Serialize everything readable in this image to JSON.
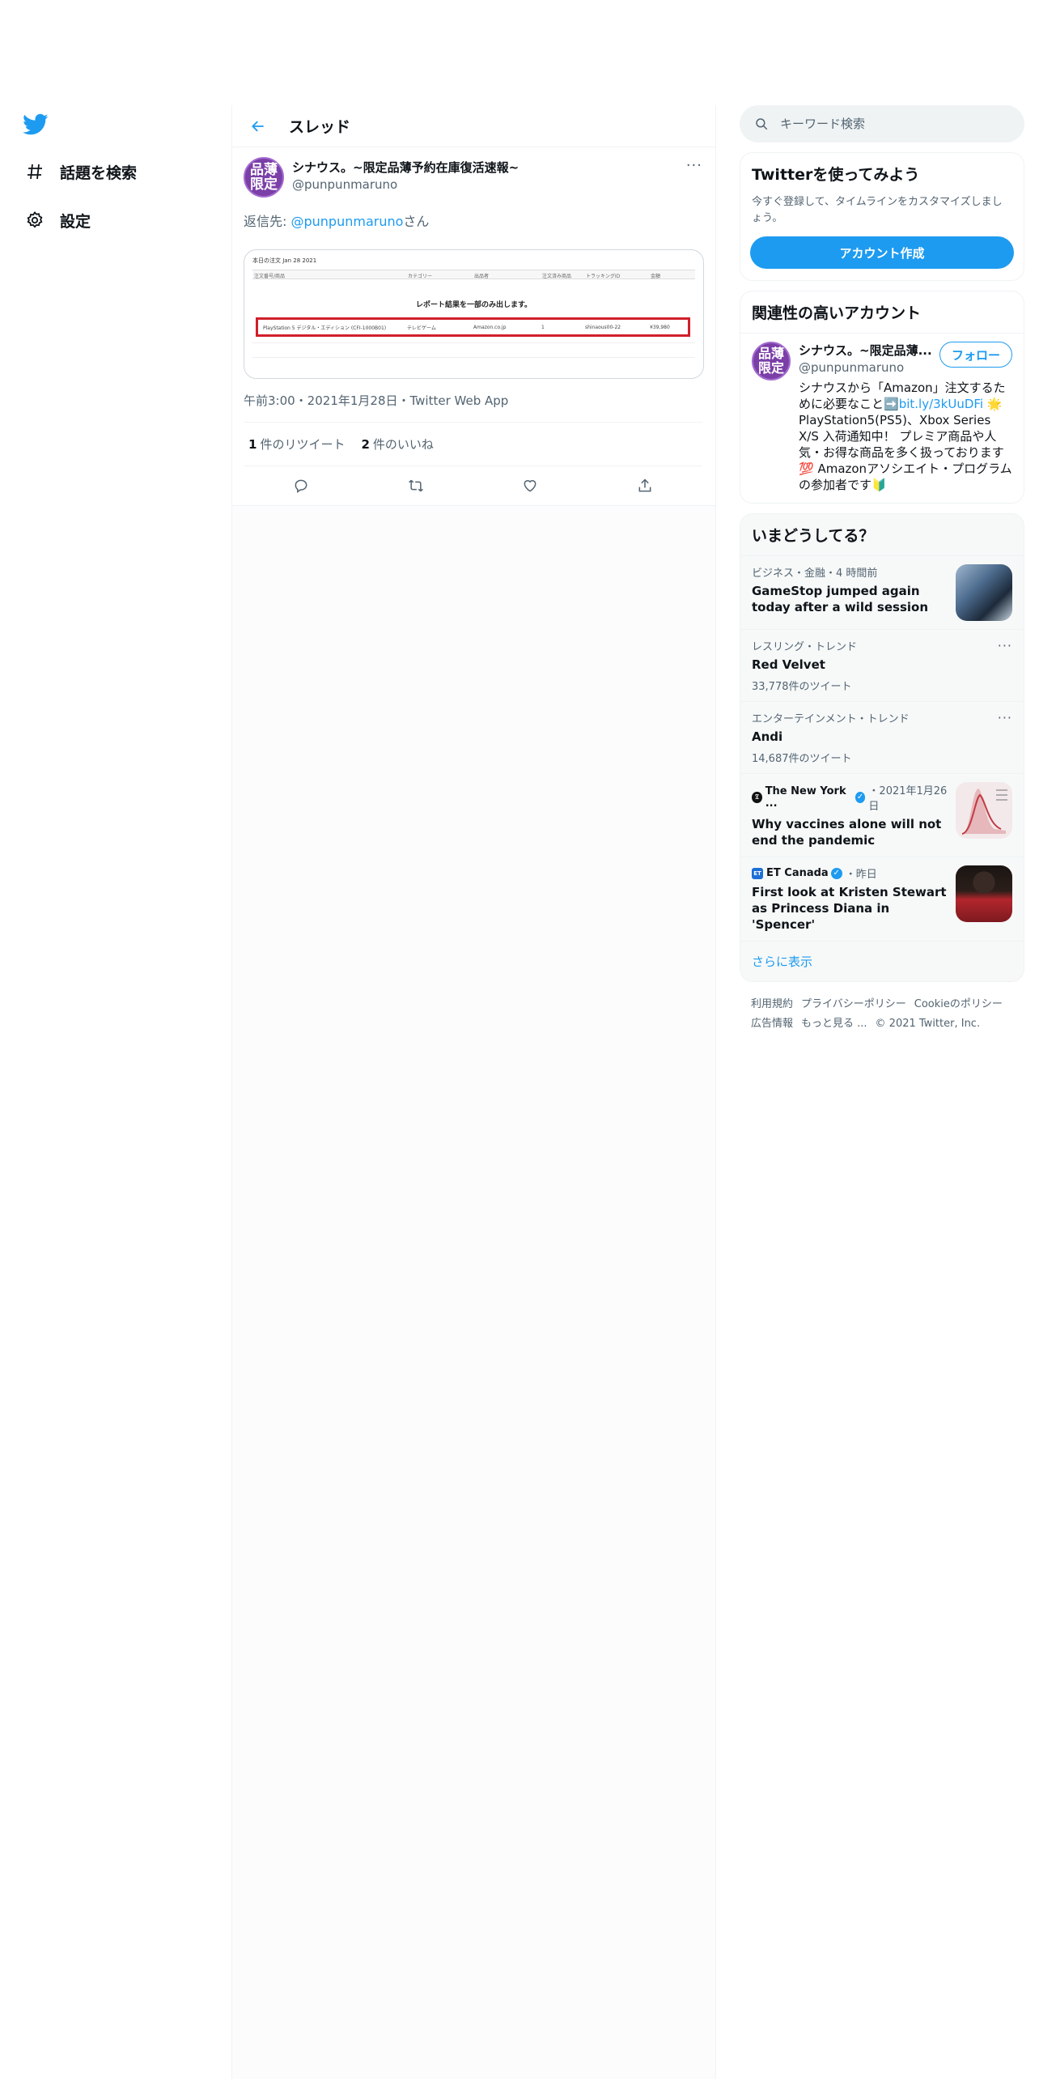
{
  "nav": {
    "explore_label": "話題を検索",
    "settings_label": "設定"
  },
  "thread": {
    "title": "スレッド",
    "tweet": {
      "avatar_text": "品薄限定",
      "display_name": "シナウス。~限定品薄予約在庫復活速報~",
      "handle": "@punpunmaruno",
      "reply_prefix": "返信先: ",
      "reply_mention": "@punpunmaruno",
      "reply_suffix": "さん",
      "timestamp": "午前3:00・2021年1月28日・Twitter Web App",
      "retweets_count": "1",
      "retweets_label": "件のリツイート",
      "likes_count": "2",
      "likes_label": "件のいいね",
      "media": {
        "header": "本日の注文 Jan 28 2021",
        "columns": [
          "注文番号/商品",
          "カテゴリー",
          "出品者",
          "注文済み商品",
          "トラッキングID",
          "金額"
        ],
        "notice": "レポート結果を一部のみ出します。",
        "row": [
          "PlayStation 5 デジタル・エディション (CFI-1000B01)",
          "テレビゲーム",
          "Amazon.co.jp",
          "1",
          "shinaous00-22",
          "¥39,980"
        ]
      }
    }
  },
  "search": {
    "placeholder": "キーワード検索"
  },
  "signup_card": {
    "title": "Twitterを使ってみよう",
    "subtitle": "今すぐ登録して、タイムラインをカスタマイズしましょう。",
    "button_label": "アカウント作成"
  },
  "related": {
    "title": "関連性の高いアカウント",
    "user": {
      "avatar_text": "品薄限定",
      "display_name": "シナウス。~限定品薄...",
      "handle": "@punpunmaruno",
      "follow_label": "フォロー",
      "bio_before": "シナウスから「Amazon」注文するために必要なこと➡️",
      "bio_link": "bit.ly/3kUuDFi",
      "bio_after": " 🌟PlayStation5(PS5)、Xbox Series X/S 入荷通知中！ プレミア商品や人気・お得な商品を多く扱っております💯 Amazonアソシエイト・プログラムの参加者です🔰"
    }
  },
  "trends": {
    "title": "いまどうしてる？",
    "items": [
      {
        "meta": "ビジネス・金融・4 時間前",
        "title": "GameStop jumped again today after a wild session"
      },
      {
        "meta": "レスリング・トレンド",
        "title": "Red Velvet",
        "count": "33,778件のツイート"
      },
      {
        "meta": "エンターテインメント・トレンド",
        "title": "Andi",
        "count": "14,687件のツイート"
      },
      {
        "source": "The New York ...",
        "time": "・2021年1月26日",
        "title": "Why vaccines alone will not end the pandemic"
      },
      {
        "source": "ET Canada",
        "time": "・昨日",
        "title": "First look at Kristen Stewart as Princess Diana in 'Spencer'"
      }
    ],
    "show_more": "さらに表示"
  },
  "footer": {
    "links": [
      "利用規約",
      "プライバシーポリシー",
      "Cookieのポリシー",
      "広告情報",
      "もっと見る ..."
    ],
    "copyright": "© 2021 Twitter, Inc."
  },
  "colors": {
    "accent": "#1d9bf0",
    "text": "#0f1419",
    "muted": "#536471",
    "avatar": "#7b3fa8"
  }
}
